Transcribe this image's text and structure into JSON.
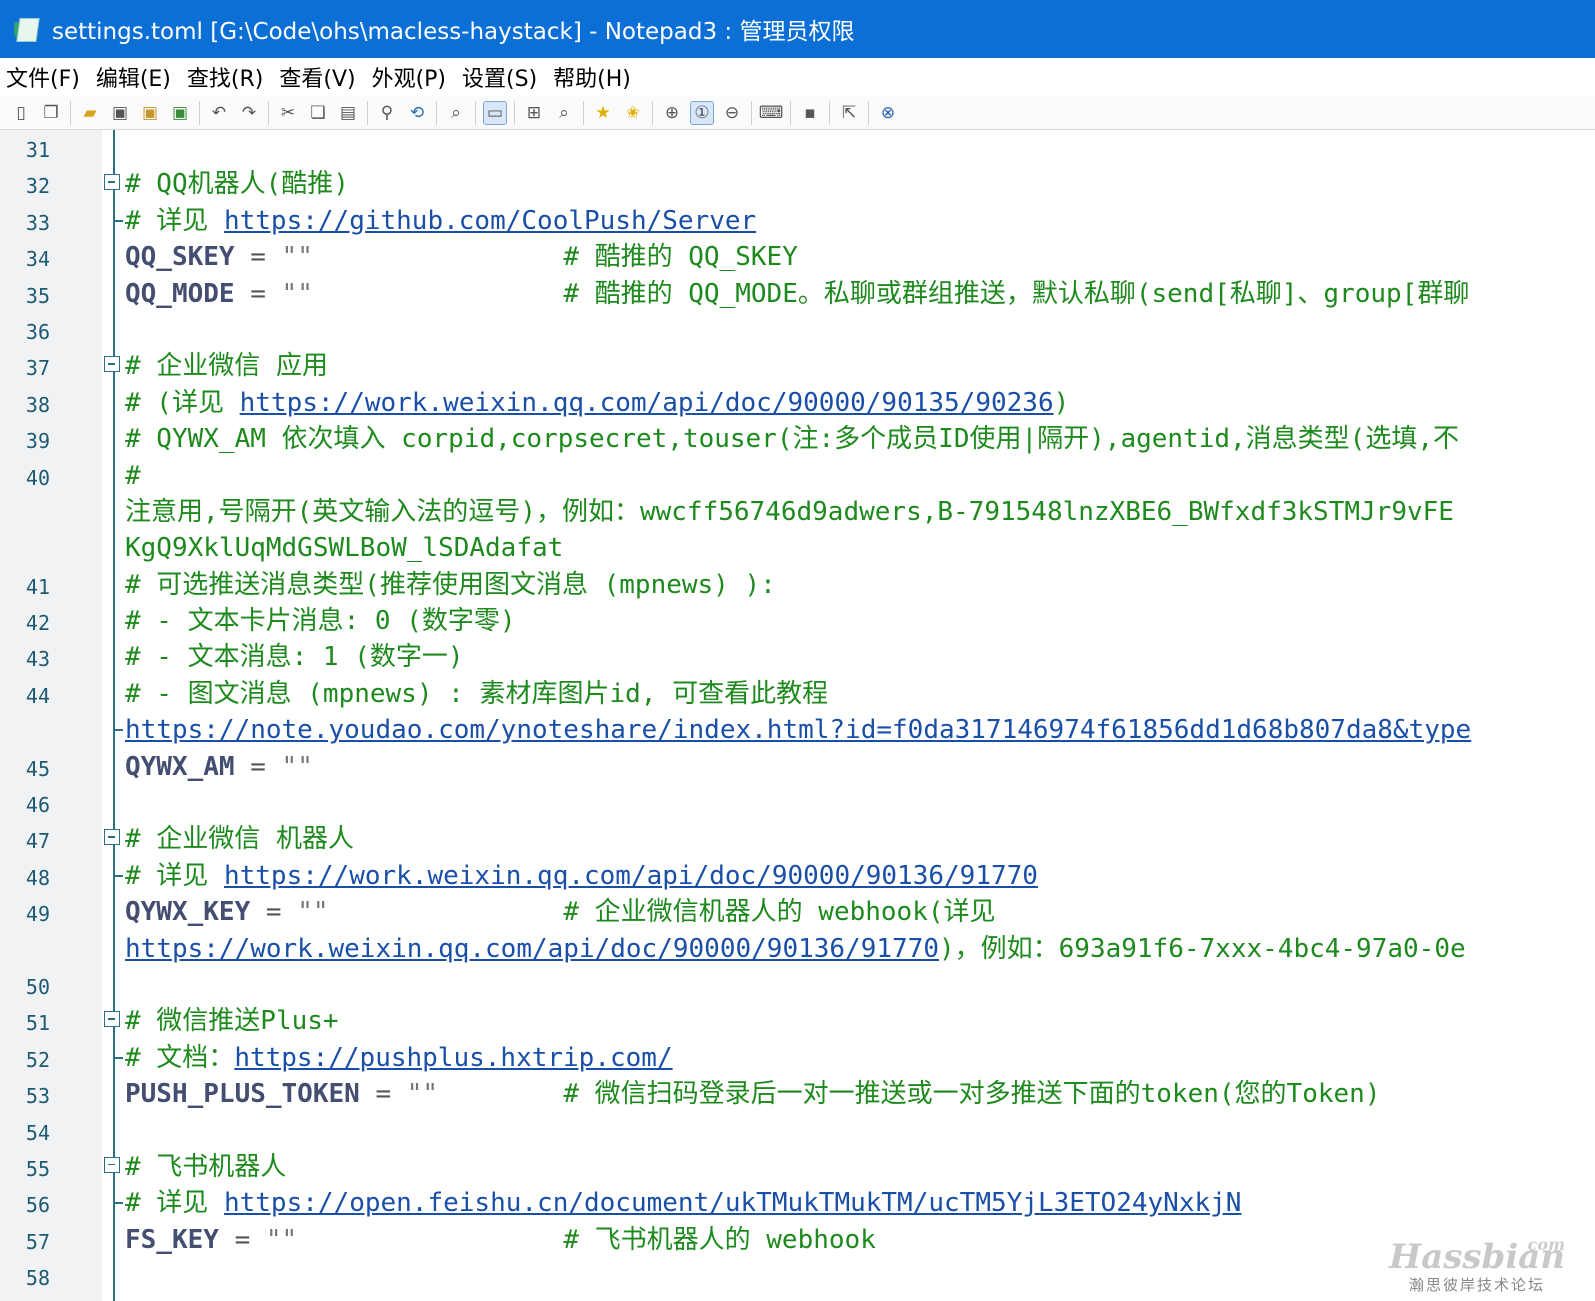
{
  "window": {
    "title": "settings.toml [G:\\Code\\ohs\\macless-haystack] - Notepad3 : 管理员权限"
  },
  "menu": [
    "文件(F)",
    "编辑(E)",
    "查找(R)",
    "查看(V)",
    "外观(P)",
    "设置(S)",
    "帮助(H)"
  ],
  "toolbar": {
    "icons": [
      "new-icon",
      "new-window-icon",
      "open-icon",
      "save-icon",
      "save-as-icon",
      "save-copy-icon",
      "undo-icon",
      "redo-icon",
      "cut-icon",
      "copy-icon",
      "paste-icon",
      "find-icon",
      "replace-icon",
      "find-next-icon",
      "word-wrap-icon",
      "fold-icon",
      "zoom-find-icon",
      "bookmark-icon",
      "add-bookmark-icon",
      "zoom-in-icon",
      "zoom-reset-icon",
      "zoom-out-icon",
      "keyboard-icon",
      "terminal-icon",
      "send-icon",
      "close-icon"
    ],
    "active": "zoom-reset-icon"
  },
  "editor": {
    "lines": [
      {
        "n": "31",
        "fold": "none",
        "segs": []
      },
      {
        "n": "32",
        "fold": "box",
        "segs": [
          {
            "t": "cmt",
            "v": "# QQ机器人(酷推)"
          }
        ]
      },
      {
        "n": "33",
        "fold": "tick",
        "segs": [
          {
            "t": "cmt",
            "v": "# 详见 "
          },
          {
            "t": "url",
            "v": "https://github.com/CoolPush/Server"
          }
        ]
      },
      {
        "n": "34",
        "fold": "none",
        "segs": [
          {
            "t": "key",
            "v": "QQ_SKEY"
          },
          {
            "t": "op",
            "v": " = "
          },
          {
            "t": "str",
            "v": "\"\""
          },
          {
            "t": "pad",
            "v": "                "
          },
          {
            "t": "cmt",
            "v": "# 酷推的 QQ_SKEY"
          }
        ]
      },
      {
        "n": "35",
        "fold": "none",
        "segs": [
          {
            "t": "key",
            "v": "QQ_MODE"
          },
          {
            "t": "op",
            "v": " = "
          },
          {
            "t": "str",
            "v": "\"\""
          },
          {
            "t": "pad",
            "v": "                "
          },
          {
            "t": "cmt",
            "v": "# 酷推的 QQ_MODE。私聊或群组推送，默认私聊(send[私聊]、group[群聊"
          }
        ]
      },
      {
        "n": "36",
        "fold": "none",
        "segs": []
      },
      {
        "n": "37",
        "fold": "box",
        "segs": [
          {
            "t": "cmt",
            "v": "# 企业微信 应用"
          }
        ]
      },
      {
        "n": "38",
        "fold": "none",
        "segs": [
          {
            "t": "cmt",
            "v": "# (详见 "
          },
          {
            "t": "url",
            "v": "https://work.weixin.qq.com/api/doc/90000/90135/90236"
          },
          {
            "t": "cmt",
            "v": ")"
          }
        ]
      },
      {
        "n": "39",
        "fold": "none",
        "segs": [
          {
            "t": "cmt",
            "v": "# QYWX_AM 依次填入 corpid,corpsecret,touser(注:多个成员ID使用|隔开),agentid,消息类型(选填,不"
          }
        ]
      },
      {
        "n": "40",
        "fold": "none",
        "segs": [
          {
            "t": "cmt",
            "v": "#"
          }
        ]
      },
      {
        "n": "",
        "fold": "none",
        "segs": [
          {
            "t": "cmt",
            "v": "注意用,号隔开(英文输入法的逗号)，例如：wwcff56746d9adwers,B-791548lnzXBE6_BWfxdf3kSTMJr9vFE"
          }
        ]
      },
      {
        "n": "",
        "fold": "none",
        "segs": [
          {
            "t": "cmt",
            "v": "KgQ9XklUqMdGSWLBoW_lSDAdafat"
          }
        ]
      },
      {
        "n": "41",
        "fold": "none",
        "segs": [
          {
            "t": "cmt",
            "v": "# 可选推送消息类型(推荐使用图文消息 (mpnews) ):"
          }
        ]
      },
      {
        "n": "42",
        "fold": "none",
        "segs": [
          {
            "t": "cmt",
            "v": "# - 文本卡片消息: 0 (数字零)"
          }
        ]
      },
      {
        "n": "43",
        "fold": "none",
        "segs": [
          {
            "t": "cmt",
            "v": "# - 文本消息: 1 (数字一)"
          }
        ]
      },
      {
        "n": "44",
        "fold": "none",
        "segs": [
          {
            "t": "cmt",
            "v": "# - 图文消息 (mpnews) : 素材库图片id, 可查看此教程"
          }
        ]
      },
      {
        "n": "",
        "fold": "tick",
        "segs": [
          {
            "t": "url",
            "v": "https://note.youdao.com/ynoteshare/index.html?id=f0da317146974f61856dd1d68b807da8&type"
          }
        ]
      },
      {
        "n": "45",
        "fold": "none",
        "segs": [
          {
            "t": "key",
            "v": "QYWX_AM"
          },
          {
            "t": "op",
            "v": " = "
          },
          {
            "t": "str",
            "v": "\"\""
          }
        ]
      },
      {
        "n": "46",
        "fold": "none",
        "segs": []
      },
      {
        "n": "47",
        "fold": "box",
        "segs": [
          {
            "t": "cmt",
            "v": "# 企业微信 机器人"
          }
        ]
      },
      {
        "n": "48",
        "fold": "tick",
        "segs": [
          {
            "t": "cmt",
            "v": "# 详见 "
          },
          {
            "t": "url",
            "v": "https://work.weixin.qq.com/api/doc/90000/90136/91770"
          }
        ]
      },
      {
        "n": "49",
        "fold": "none",
        "segs": [
          {
            "t": "key",
            "v": "QYWX_KEY"
          },
          {
            "t": "op",
            "v": " = "
          },
          {
            "t": "str",
            "v": "\"\""
          },
          {
            "t": "pad",
            "v": "               "
          },
          {
            "t": "cmt",
            "v": "# 企业微信机器人的 webhook(详见"
          }
        ]
      },
      {
        "n": "",
        "fold": "none",
        "segs": [
          {
            "t": "url",
            "v": "https://work.weixin.qq.com/api/doc/90000/90136/91770"
          },
          {
            "t": "cmt",
            "v": ")，例如：693a91f6-7xxx-4bc4-97a0-0e"
          }
        ]
      },
      {
        "n": "50",
        "fold": "none",
        "segs": []
      },
      {
        "n": "51",
        "fold": "box",
        "segs": [
          {
            "t": "cmt",
            "v": "# 微信推送Plus+"
          }
        ]
      },
      {
        "n": "52",
        "fold": "tick",
        "segs": [
          {
            "t": "cmt",
            "v": "# 文档："
          },
          {
            "t": "url",
            "v": "https://pushplus.hxtrip.com/"
          }
        ]
      },
      {
        "n": "53",
        "fold": "none",
        "segs": [
          {
            "t": "key",
            "v": "PUSH_PLUS_TOKEN"
          },
          {
            "t": "op",
            "v": " = "
          },
          {
            "t": "str",
            "v": "\"\""
          },
          {
            "t": "pad",
            "v": "        "
          },
          {
            "t": "cmt",
            "v": "# 微信扫码登录后一对一推送或一对多推送下面的token(您的Token)"
          }
        ]
      },
      {
        "n": "54",
        "fold": "none",
        "segs": []
      },
      {
        "n": "55",
        "fold": "box",
        "segs": [
          {
            "t": "cmt",
            "v": "# 飞书机器人"
          }
        ]
      },
      {
        "n": "56",
        "fold": "tick",
        "segs": [
          {
            "t": "cmt",
            "v": "# 详见 "
          },
          {
            "t": "url",
            "v": "https://open.feishu.cn/document/ukTMukTMukTM/ucTM5YjL3ETO24yNxkjN"
          }
        ]
      },
      {
        "n": "57",
        "fold": "none",
        "segs": [
          {
            "t": "key",
            "v": "FS_KEY"
          },
          {
            "t": "op",
            "v": " = "
          },
          {
            "t": "str",
            "v": "\"\""
          },
          {
            "t": "pad",
            "v": "                 "
          },
          {
            "t": "cmt",
            "v": "# 飞书机器人的 webhook"
          }
        ]
      },
      {
        "n": "58",
        "fold": "none",
        "segs": []
      }
    ]
  },
  "watermark": {
    "logo": "Hassbian",
    "com": "com",
    "sub": "瀚思彼岸技术论坛"
  }
}
